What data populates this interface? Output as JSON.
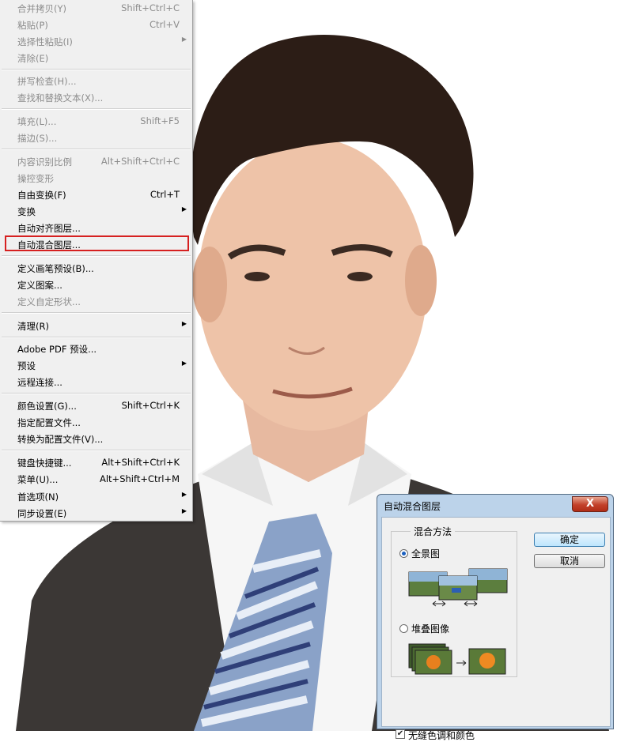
{
  "edit_menu": {
    "items": [
      {
        "label": "合并拷贝(Y)",
        "shortcut": "Shift+Ctrl+C",
        "disabled": true
      },
      {
        "label": "粘贴(P)",
        "shortcut": "Ctrl+V",
        "disabled": true
      },
      {
        "label": "选择性粘贴(I)",
        "shortcut": "",
        "disabled": true
      },
      {
        "label": "清除(E)",
        "shortcut": "",
        "disabled": true
      },
      {
        "label": "拼写检查(H)...",
        "shortcut": "",
        "disabled": true
      },
      {
        "label": "查找和替换文本(X)...",
        "shortcut": "",
        "disabled": true
      },
      {
        "label": "填充(L)...",
        "shortcut": "Shift+F5",
        "disabled": true
      },
      {
        "label": "描边(S)...",
        "shortcut": "",
        "disabled": true
      },
      {
        "label": "内容识别比例",
        "shortcut": "Alt+Shift+Ctrl+C",
        "disabled": true
      },
      {
        "label": "操控变形",
        "shortcut": "",
        "disabled": true
      },
      {
        "label": "自由变换(F)",
        "shortcut": "Ctrl+T",
        "disabled": false
      },
      {
        "label": "变换",
        "shortcut": "",
        "disabled": false
      },
      {
        "label": "自动对齐图层...",
        "shortcut": "",
        "disabled": false
      },
      {
        "label": "自动混合图层...",
        "shortcut": "",
        "disabled": false
      },
      {
        "label": "定义画笔预设(B)...",
        "shortcut": "",
        "disabled": false
      },
      {
        "label": "定义图案...",
        "shortcut": "",
        "disabled": false
      },
      {
        "label": "定义自定形状...",
        "shortcut": "",
        "disabled": true
      },
      {
        "label": "清理(R)",
        "shortcut": "",
        "disabled": false
      },
      {
        "label": "Adobe PDF 预设...",
        "shortcut": "",
        "disabled": false
      },
      {
        "label": "预设",
        "shortcut": "",
        "disabled": false
      },
      {
        "label": "远程连接...",
        "shortcut": "",
        "disabled": false
      },
      {
        "label": "颜色设置(G)...",
        "shortcut": "Shift+Ctrl+K",
        "disabled": false
      },
      {
        "label": "指定配置文件...",
        "shortcut": "",
        "disabled": false
      },
      {
        "label": "转换为配置文件(V)...",
        "shortcut": "",
        "disabled": false
      },
      {
        "label": "键盘快捷键...",
        "shortcut": "Alt+Shift+Ctrl+K",
        "disabled": false
      },
      {
        "label": "菜单(U)...",
        "shortcut": "Alt+Shift+Ctrl+M",
        "disabled": false
      },
      {
        "label": "首选项(N)",
        "shortcut": "",
        "disabled": false
      },
      {
        "label": "同步设置(E)",
        "shortcut": "",
        "disabled": false
      }
    ],
    "highlighted_item": "自动混合图层...",
    "highlight_color": "#d62020"
  },
  "dialog": {
    "title": "自动混合图层",
    "close_label": "X",
    "group_label": "混合方法",
    "option_panorama": "全景图",
    "option_stack": "堆叠图像",
    "selected_option": "全景图",
    "ok_label": "确定",
    "cancel_label": "取消",
    "checkbox_label": "无缝色调和颜色",
    "checkbox_checked": true
  },
  "icons": {
    "submenu_arrow": "submenu-arrow-icon",
    "close": "close-icon",
    "checkmark": "checkmark-icon"
  },
  "colors": {
    "menu_bg": "#f0f0f0",
    "disabled_text": "#8c8c8c",
    "dialog_frame": "#bcd3ea",
    "close_button": "#c2402a"
  }
}
